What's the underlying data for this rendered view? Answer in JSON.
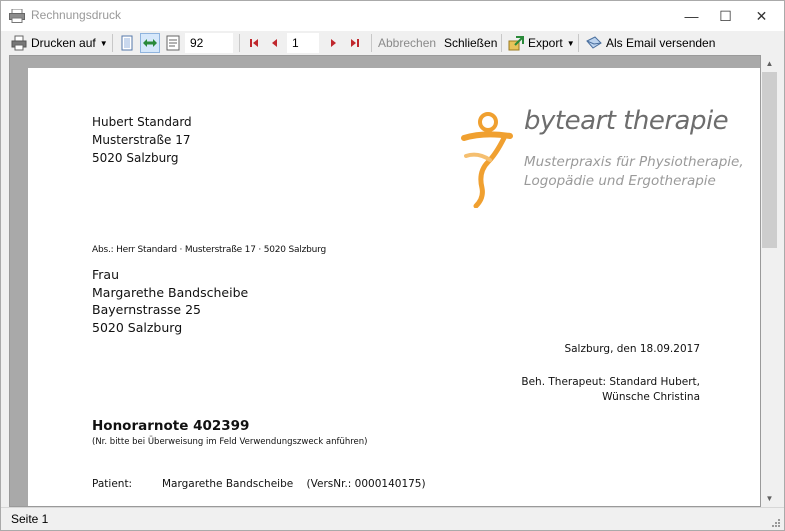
{
  "window": {
    "title": "Rechnungsdruck",
    "minimize_glyph": "—",
    "maximize_glyph": "☐",
    "close_glyph": "✕"
  },
  "toolbar": {
    "print_label": "Drucken auf",
    "zoom_value": "92",
    "page_value": "1",
    "cancel_label": "Abbrechen",
    "close_label": "Schließen",
    "export_label": "Export",
    "email_label": "Als Email versenden"
  },
  "document": {
    "sender": [
      "Hubert Standard",
      "Musterstraße 17",
      "5020 Salzburg"
    ],
    "return_address": "Abs.: Herr Standard · Musterstraße 17 · 5020 Salzburg",
    "recipient": [
      "Frau",
      "Margarethe Bandscheibe",
      "Bayernstrasse 25",
      "5020 Salzburg"
    ],
    "date_line": "Salzburg, den 18.09.2017",
    "therapist_lines": [
      "Beh. Therapeut: Standard Hubert,",
      "Wünsche Christina"
    ],
    "invoice_title": "Honorarnote 402399",
    "invoice_note": "(Nr. bitte bei Überweisung im Feld Verwendungszweck anführen)",
    "patient_label": "Patient:",
    "patient_value": "Margarethe Bandscheibe    (VersNr.: 0000140175)",
    "logo": {
      "name": "byteart therapie",
      "subtitle_lines": [
        "Musterpraxis für Physiotherapie,",
        "Logopädie und Ergotherapie"
      ],
      "accent_color": "#f0a030"
    }
  },
  "status": {
    "page_label": "Seite 1"
  }
}
